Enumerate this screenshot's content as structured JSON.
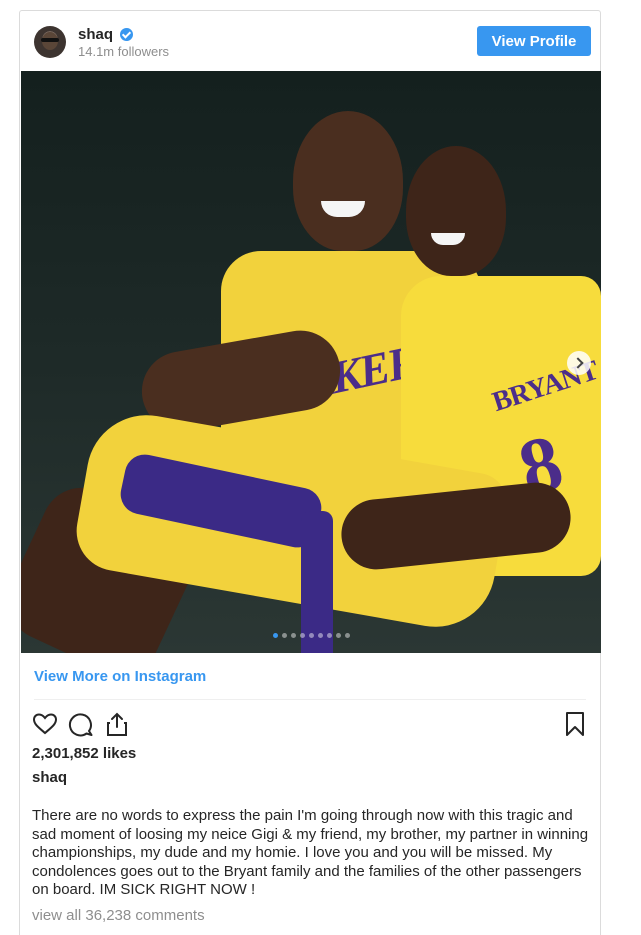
{
  "header": {
    "username": "shaq",
    "followers": "14.1m followers",
    "view_profile_label": "View Profile"
  },
  "media": {
    "carousel_count": 9,
    "carousel_active_index": 0
  },
  "view_more_label": "View More on Instagram",
  "icons": [
    "heart-icon",
    "comment-icon",
    "share-icon",
    "bookmark-icon",
    "verified-badge-icon",
    "next-arrow-icon"
  ],
  "likes": "2,301,852 likes",
  "caption": {
    "owner": "shaq",
    "text": "There are no words to express the pain I'm going through now with this tragic and sad moment of loosing my neice Gigi & my friend, my brother, my partner in winning championships, my dude and my homie. I love you and you will be missed. My condolences goes out to the Bryant family and the families of the other passengers on board. IM SICK RIGHT NOW !"
  },
  "comments_label": "view all 36,238 comments",
  "colors": {
    "accent": "#3897f0",
    "text": "#262626",
    "muted": "#8e8e8e",
    "border": "#dbdbdb"
  }
}
